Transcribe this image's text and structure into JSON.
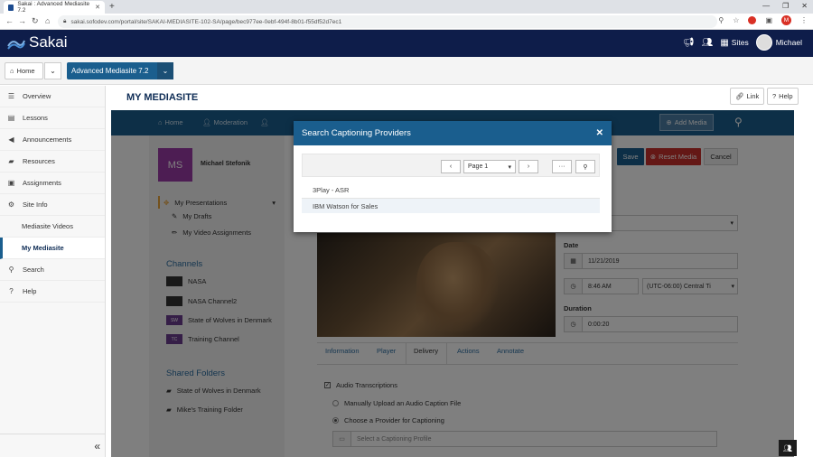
{
  "browser": {
    "tab_title": "Sakai : Advanced Mediasite 7.2",
    "url": "sakai.sofodev.com/portal/site/SAKAI-MEDIASITE-102-SA/page/bec977ee-0ebf-494f-8b01-f55df52d7ec1",
    "profile_initial": "M"
  },
  "header": {
    "logo_text": "Sakai",
    "sites_label": "Sites",
    "user_name": "Michael"
  },
  "sitenav": {
    "home_label": "Home",
    "site_label": "Advanced Mediasite 7.2"
  },
  "tools": [
    {
      "label": "Overview",
      "icon": "list-icon"
    },
    {
      "label": "Lessons",
      "icon": "book-icon"
    },
    {
      "label": "Announcements",
      "icon": "megaphone-icon"
    },
    {
      "label": "Resources",
      "icon": "folder-icon"
    },
    {
      "label": "Assignments",
      "icon": "clipboard-icon"
    },
    {
      "label": "Site Info",
      "icon": "gear-icon"
    },
    {
      "label": "Mediasite Videos"
    },
    {
      "label": "My Mediasite"
    },
    {
      "label": "Search",
      "icon": "search-icon"
    },
    {
      "label": "Help",
      "icon": "help-icon"
    }
  ],
  "page": {
    "title": "MY MEDIASITE",
    "link_label": "Link",
    "help_label": "Help"
  },
  "mediasite": {
    "nav": {
      "home": "Home",
      "moderation": "Moderation",
      "add_media": "Add Media"
    },
    "user": {
      "initials": "MS",
      "name": "Michael Stefonik"
    },
    "links": {
      "presentations": "My Presentations",
      "drafts": "My Drafts",
      "assignments": "My Video Assignments"
    },
    "channels_heading": "Channels",
    "channels": [
      {
        "name": "NASA",
        "thumb": ""
      },
      {
        "name": "NASA Channel2",
        "thumb": ""
      },
      {
        "name": "State of Wolves in Denmark",
        "thumb": "SW"
      },
      {
        "name": "Training Channel",
        "thumb": "TC"
      }
    ],
    "shared_heading": "Shared Folders",
    "shared": [
      "State of Wolves in Denmark",
      "Mike's Training Folder"
    ],
    "buttons": {
      "save": "Save",
      "reset": "Reset Media",
      "cancel": "Cancel"
    },
    "date_label": "Date",
    "date_value": "11/21/2019",
    "time_value": "8:46 AM",
    "timezone_value": "(UTC-06:00) Central Ti",
    "duration_label": "Duration",
    "duration_value": "0:00:20",
    "tabs": [
      "Information",
      "Player",
      "Delivery",
      "Actions",
      "Annotate"
    ],
    "active_tab": "Delivery",
    "audio_transcriptions": "Audio Transcriptions",
    "manual_upload": "Manually Upload an Audio Caption File",
    "choose_provider": "Choose a Provider for Captioning",
    "profile_placeholder": "Select a Captioning Profile"
  },
  "modal": {
    "title": "Search Captioning Providers",
    "page_label": "Page 1",
    "providers": [
      "3Play - ASR",
      "IBM Watson for Sales"
    ]
  },
  "colors": {
    "sakai_navy": "#0e1d4a",
    "mediasite_blue": "#1a5e8e",
    "reset_red": "#c9302c",
    "avatar_purple": "#9b3aa6"
  }
}
